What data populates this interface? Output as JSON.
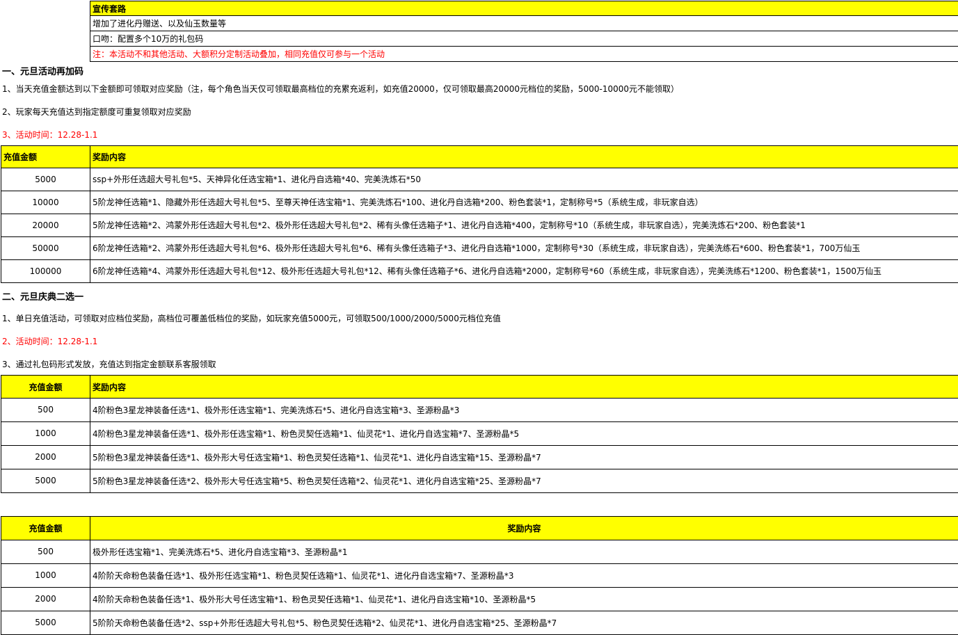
{
  "promo": {
    "header": "宣传套路",
    "rows": [
      {
        "text": "增加了进化丹赠送、以及仙玉数量等",
        "red": false
      },
      {
        "text": "口吻：配置多个10万的礼包码",
        "red": false
      },
      {
        "text": "注：本活动不和其他活动、大额积分定制活动叠加，相同充值仅可参与一个活动",
        "red": true
      }
    ]
  },
  "section1": {
    "title": "一、元旦活动再加码",
    "lines": [
      {
        "text": "1、当天充值金额达到以下金额即可领取对应奖励（注，每个角色当天仅可领取最高档位的充累充返利，如充值20000，仅可领取最高20000元档位的奖励，5000-10000元不能领取）",
        "red": false
      },
      {
        "text": "2、玩家每天充值达到指定额度可重复领取对应奖励",
        "red": false
      },
      {
        "text": "3、活动时间：12.28-1.1",
        "red": true
      }
    ],
    "table": {
      "headers": [
        "充值金额",
        "奖励内容"
      ],
      "rows": [
        [
          "5000",
          "ssp+外形任选超大号礼包*5、天神异化任选宝箱*1、进化丹自选箱*40、完美洗炼石*50"
        ],
        [
          "10000",
          "5阶龙神任选箱*1、隐藏外形任选超大号礼包*5、至尊天神任选宝箱*1、完美洗炼石*100、进化丹自选箱*200、粉色套装*1，定制称号*5（系统生成，非玩家自选）"
        ],
        [
          "20000",
          "5阶龙神任选箱*2、鸿蒙外形任选超大号礼包*2、极外形任选超大号礼包*2、稀有头像任选箱子*1、进化丹自选箱*400，定制称号*10（系统生成，非玩家自选），完美洗炼石*200、粉色套装*1"
        ],
        [
          "50000",
          "6阶龙神任选箱*2、鸿蒙外形任选超大号礼包*6、极外形任选超大号礼包*6、稀有头像任选箱子*3、进化丹自选箱*1000，定制称号*30（系统生成，非玩家自选），完美洗练石*600、粉色套装*1，700万仙玉"
        ],
        [
          "100000",
          "6阶龙神任选箱*4、鸿蒙外形任选超大号礼包*12、极外形任选超大号礼包*12、稀有头像任选箱子*6、进化丹自选箱*2000，定制称号*60（系统生成，非玩家自选），完美洗练石*1200、粉色套装*1，1500万仙玉"
        ]
      ]
    }
  },
  "section2": {
    "title": "二、元旦庆典二选一",
    "lines": [
      {
        "text": "1、单日充值活动，可领取对应档位奖励，高档位可覆盖低档位的奖励，如玩家充值5000元，可领取500/1000/2000/5000元档位充值",
        "red": false
      },
      {
        "text": "2、活动时间：12.28-1.1",
        "red": true
      },
      {
        "text": "3、通过礼包码形式发放，充值达到指定金额联系客服领取",
        "red": false
      }
    ],
    "table1": {
      "headers": [
        "充值金额",
        "奖励内容"
      ],
      "rows": [
        [
          "500",
          "4阶粉色3星龙神装备任选*1、极外形任选宝箱*1、完美洗炼石*5、进化丹自选宝箱*3、圣源粉晶*3"
        ],
        [
          "1000",
          "4阶粉色3星龙神装备任选*1、极外形任选宝箱*1、粉色灵契任选箱*1、仙灵花*1、进化丹自选宝箱*7、圣源粉晶*5"
        ],
        [
          "2000",
          "5阶粉色3星龙神装备任选*1、极外形大号任选宝箱*1、粉色灵契任选箱*1、仙灵花*1、进化丹自选宝箱*15、圣源粉晶*7"
        ],
        [
          "5000",
          "5阶粉色3星龙神装备任选*2、极外形大号任选宝箱*5、粉色灵契任选箱*2、仙灵花*1、进化丹自选宝箱*25、圣源粉晶*7"
        ]
      ]
    },
    "table2": {
      "headers": [
        "充值金额",
        "奖励内容"
      ],
      "rows": [
        [
          "500",
          "极外形任选宝箱*1、完美洗炼石*5、进化丹自选宝箱*3、圣源粉晶*1"
        ],
        [
          "1000",
          "4阶阶天命粉色装备任选*1、极外形任选宝箱*1、粉色灵契任选箱*1、仙灵花*1、进化丹自选宝箱*7、圣源粉晶*3"
        ],
        [
          "2000",
          "4阶阶天命粉色装备任选*1、极外形大号任选宝箱*1、粉色灵契任选箱*1、仙灵花*1、进化丹自选宝箱*10、圣源粉晶*5"
        ],
        [
          "5000",
          "5阶阶天命粉色装备任选*2、ssp+外形任选超大号礼包*5、粉色灵契任选箱*2、仙灵花*1、进化丹自选宝箱*25、圣源粉晶*7"
        ]
      ]
    }
  }
}
